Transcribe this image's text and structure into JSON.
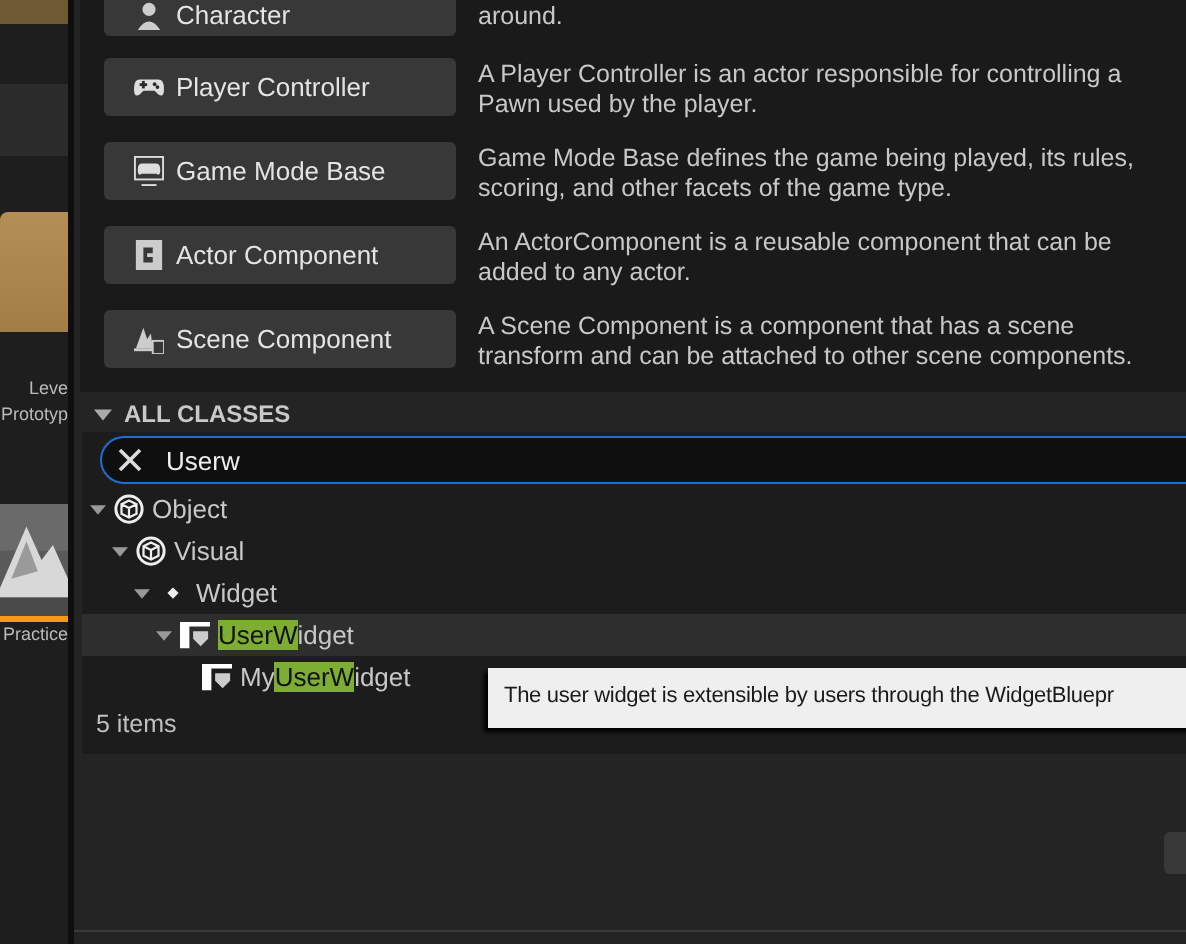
{
  "background": {
    "labels": [
      "Leve",
      "Prototyp"
    ],
    "thumbnail_label": "Practice"
  },
  "common_classes": [
    {
      "kind": "character",
      "label": "Character",
      "description": "around."
    },
    {
      "kind": "controller",
      "label": "Player Controller",
      "description": "A Player Controller is an actor responsible for controlling a Pawn used by the player."
    },
    {
      "kind": "gamemode",
      "label": "Game Mode Base",
      "description": "Game Mode Base defines the game being played, its rules, scoring, and other facets of the game type."
    },
    {
      "kind": "actorcomp",
      "label": "Actor Component",
      "description": "An ActorComponent is a reusable component that can be added to any actor."
    },
    {
      "kind": "scenecomp",
      "label": "Scene Component",
      "description": "A Scene Component is a component that has a scene transform and can be attached to other scene components."
    }
  ],
  "all_classes": {
    "title": "ALL CLASSES",
    "expanded": true,
    "search": {
      "value": "Userw"
    },
    "tree": [
      {
        "kind": "object",
        "prefix": "Object",
        "expanded": true,
        "selected": false,
        "children": [
          {
            "kind": "object",
            "prefix": "Visual",
            "expanded": true,
            "selected": false,
            "children": [
              {
                "kind": "dot",
                "prefix": "Widget",
                "expanded": true,
                "selected": false,
                "children": [
                  {
                    "kind": "userwidget",
                    "match": "UserW",
                    "rest": "idget",
                    "expanded": true,
                    "selected": true,
                    "children": [
                      {
                        "kind": "userwidget",
                        "prefix": "My",
                        "match": "UserW",
                        "rest": "idget",
                        "selected": false
                      }
                    ]
                  }
                ]
              }
            ]
          }
        ]
      }
    ],
    "count": "5 items"
  },
  "tooltip": "The user widget is extensible by users through the WidgetBluepr"
}
